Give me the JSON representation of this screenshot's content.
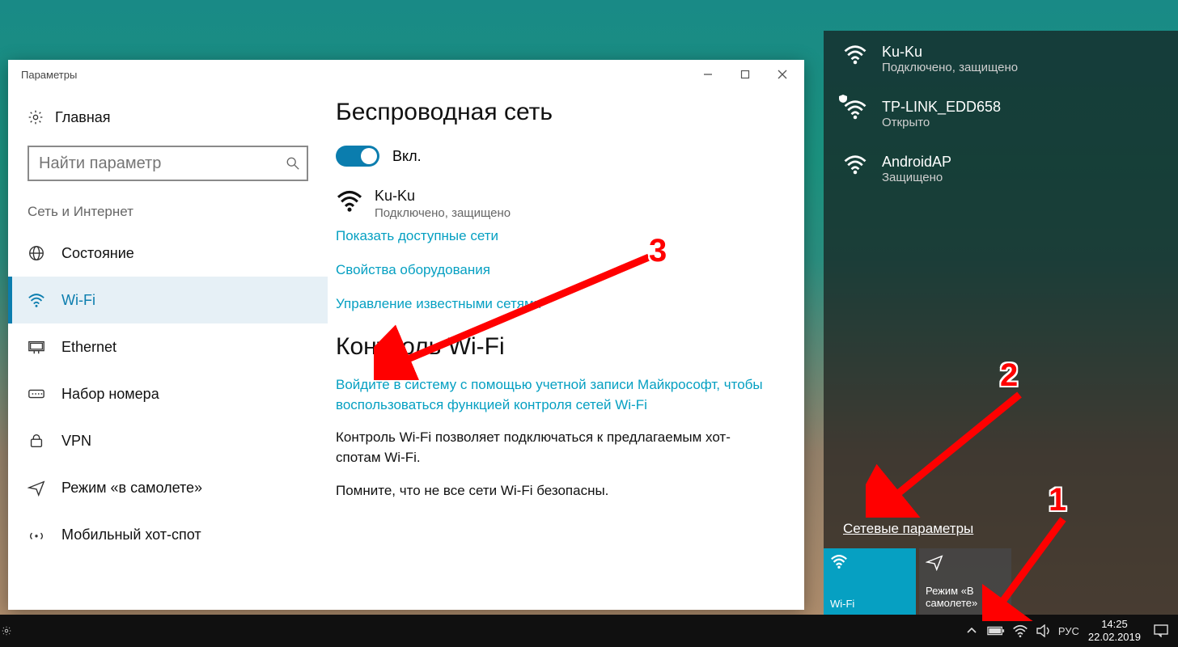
{
  "settings": {
    "window_title": "Параметры",
    "home_label": "Главная",
    "search_placeholder": "Найти параметр",
    "section_label": "Сеть и Интернет",
    "nav": [
      {
        "label": "Состояние",
        "icon": "globe"
      },
      {
        "label": "Wi-Fi",
        "icon": "wifi",
        "selected": true
      },
      {
        "label": "Ethernet",
        "icon": "ethernet"
      },
      {
        "label": "Набор номера",
        "icon": "dialup"
      },
      {
        "label": "VPN",
        "icon": "vpn"
      },
      {
        "label": "Режим «в самолете»",
        "icon": "airplane"
      },
      {
        "label": "Мобильный хот-спот",
        "icon": "hotspot"
      }
    ],
    "main": {
      "heading": "Беспроводная сеть",
      "toggle_label": "Вкл.",
      "network_name": "Ku-Ku",
      "network_status": "Подключено, защищено",
      "link_show": "Показать доступные сети",
      "link_hw": "Свойства оборудования",
      "link_known": "Управление известными сетями",
      "control_heading": "Контроль Wi-Fi",
      "control_link": "Войдите в систему с помощью учетной записи Майкрософт, чтобы воспользоваться функцией контроля сетей Wi-Fi",
      "control_text1": "Контроль Wi-Fi позволяет подключаться к предлагаемым хот-спотам Wi-Fi.",
      "control_text2": "Помните, что не все сети Wi-Fi безопасны."
    }
  },
  "flyout": {
    "networks": [
      {
        "name": "Ku-Ku",
        "status": "Подключено, защищено",
        "open_warn": false
      },
      {
        "name": "TP-LINK_EDD658",
        "status": "Открыто",
        "open_warn": true
      },
      {
        "name": "AndroidAP",
        "status": "Защищено",
        "open_warn": false
      }
    ],
    "settings_link": "Сетевые параметры",
    "tile_wifi": "Wi-Fi",
    "tile_airplane": "Режим «В самолете»"
  },
  "taskbar": {
    "lang": "РУС",
    "time": "14:25",
    "date": "22.02.2019"
  },
  "annotations": {
    "n1": "1",
    "n2": "2",
    "n3": "3"
  },
  "colors": {
    "accent": "#0b7dae",
    "link": "#06a0c2",
    "annot": "#f00"
  }
}
